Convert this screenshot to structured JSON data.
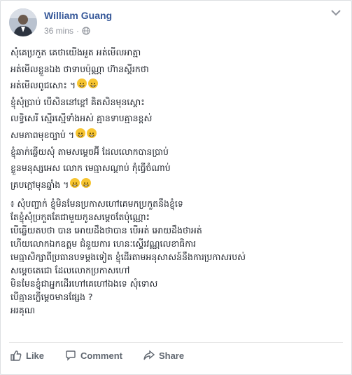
{
  "post": {
    "author": "William Guang",
    "time": "36 mins",
    "privacy_icon": "globe-icon",
    "lines": [
      "សុំគេប្រកួត គេថាយើងអួត អត់មើលអាត្មា",
      "អត់មើលខ្លួនឯង ថាទាបប៉ុណ្ណា ហ៊ានស្ដីរកថា",
      "អត់មើលពូជសោះ ។",
      "ខ្ញុំសុំប្រាប់ បើសិននៅខ្ពៅ គិតសិនមុនស្ដោះ",
      "លទ្ធិសេរី ស្មើរស្មើទាំងអស់ គ្មានទាបគ្មានខ្ពស់",
      "សមភាពមុខច្បាប់ ។",
      "ខ្ញុំឆាក់ឆ្លើយសុំ តាមសម្ដេចអ៊ី ដែលលោកបានប្រាប់",
      "ខ្លួនមនុស្សអេស លោក មេធ្មាសណ្ដាប់ កុំធ្វើចំណាប់",
      "គ្របក្ដៅមុនឆ្នាំង ។",
      "៖ សុំបញ្ជាក់ ខ្ញុំមិនមែនប្រកាសហៅគេមកប្រកួតនឹងខ្ញុំទេ",
      "តែខ្ញុំសុំប្រកួតតែជាមួយកូនសម្ដេចតែប៉ុណ្ណោះ",
      "បើឆ្លើយតបថា បាន អោយដឹងថាបាន បើអត់ អោយដឹងថាអត់",
      "ហើយលោកឯកឧត្ដម ជំនួយការ ហេនៈស្ទើរវណ្ណលេខាធិការ",
      "មេធ្មាសិក្សាពីប្រធានបទម្ដងទៀត ខ្ញុំដើរតាមអនុសាសន៍នឹងការប្រកាសរបស់",
      "សម្ដេចតេជោ ដែលលោកប្រកាសហៅ",
      "មិនមែនខ្ញុំជាអ្នកដើរហៅគេហៅឯងទេ សុំទោស",
      "បើគ្មានក្លើម្ដេចមានផ្សែង ?",
      "អរគុណ"
    ],
    "emoji_lines": [
      2,
      5,
      8
    ],
    "emoji_name": "grinning-face-emoji"
  },
  "actions": {
    "like": "Like",
    "comment": "Comment",
    "share": "Share"
  },
  "colors": {
    "author": "#365899",
    "meta": "#90949c",
    "text": "#1d2129",
    "action": "#606770"
  }
}
